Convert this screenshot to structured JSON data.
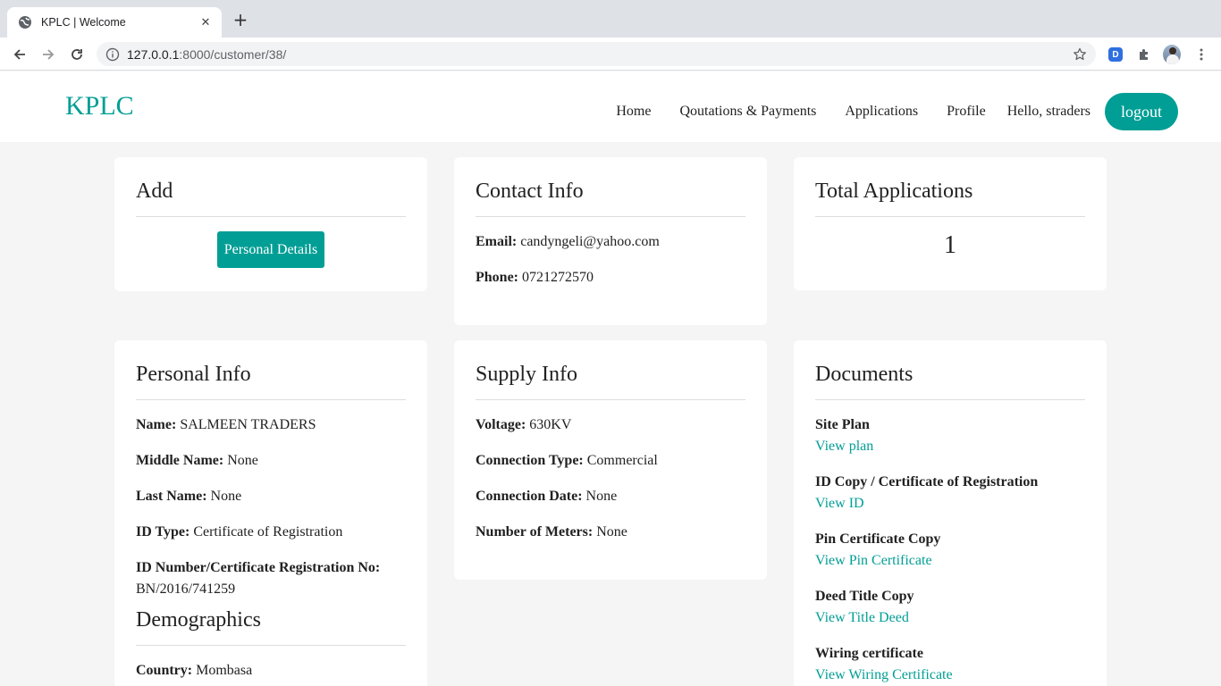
{
  "browser": {
    "tab_title": "KPLC | Welcome",
    "url_host": "127.0.0.1",
    "url_path": ":8000/customer/38/",
    "extension_label": "D"
  },
  "site": {
    "brand": "KPLC",
    "nav": [
      "Home",
      "Qoutations & Payments",
      "Applications",
      "Profile"
    ],
    "greeting": "Hello, straders",
    "logout": "logout"
  },
  "add_card": {
    "title": "Add",
    "button": "Personal Details"
  },
  "contact_card": {
    "title": "Contact Info",
    "email_label": "Email:",
    "email": "candyngeli@yahoo.com",
    "phone_label": "Phone:",
    "phone": "0721272570"
  },
  "total_card": {
    "title": "Total Applications",
    "count": "1"
  },
  "personal_card": {
    "title": "Personal Info",
    "rows": [
      {
        "label": "Name:",
        "value": "SALMEEN TRADERS"
      },
      {
        "label": "Middle Name:",
        "value": "None"
      },
      {
        "label": "Last Name:",
        "value": "None"
      },
      {
        "label": "ID Type:",
        "value": "Certificate of Registration"
      },
      {
        "label": "ID Number/Certificate Registration No:",
        "value": "BN/2016/741259"
      }
    ],
    "demographics_title": "Demographics",
    "country_label": "Country:",
    "country": "Mombasa"
  },
  "supply_card": {
    "title": "Supply Info",
    "rows": [
      {
        "label": "Voltage:",
        "value": "630KV"
      },
      {
        "label": "Connection Type:",
        "value": "Commercial"
      },
      {
        "label": "Connection Date:",
        "value": "None"
      },
      {
        "label": "Number of Meters:",
        "value": "None"
      }
    ]
  },
  "documents_card": {
    "title": "Documents",
    "docs": [
      {
        "title": "Site Plan",
        "link": "View plan"
      },
      {
        "title": "ID Copy / Certificate of Registration",
        "link": "View ID"
      },
      {
        "title": "Pin Certificate Copy",
        "link": "View Pin Certificate"
      },
      {
        "title": "Deed Title Copy",
        "link": "View Title Deed"
      },
      {
        "title": "Wiring certificate",
        "link": "View Wiring Certificate"
      }
    ]
  },
  "colors": {
    "accent": "#009e95",
    "page_bg": "#f5f5f5",
    "card_bg": "#ffffff"
  }
}
